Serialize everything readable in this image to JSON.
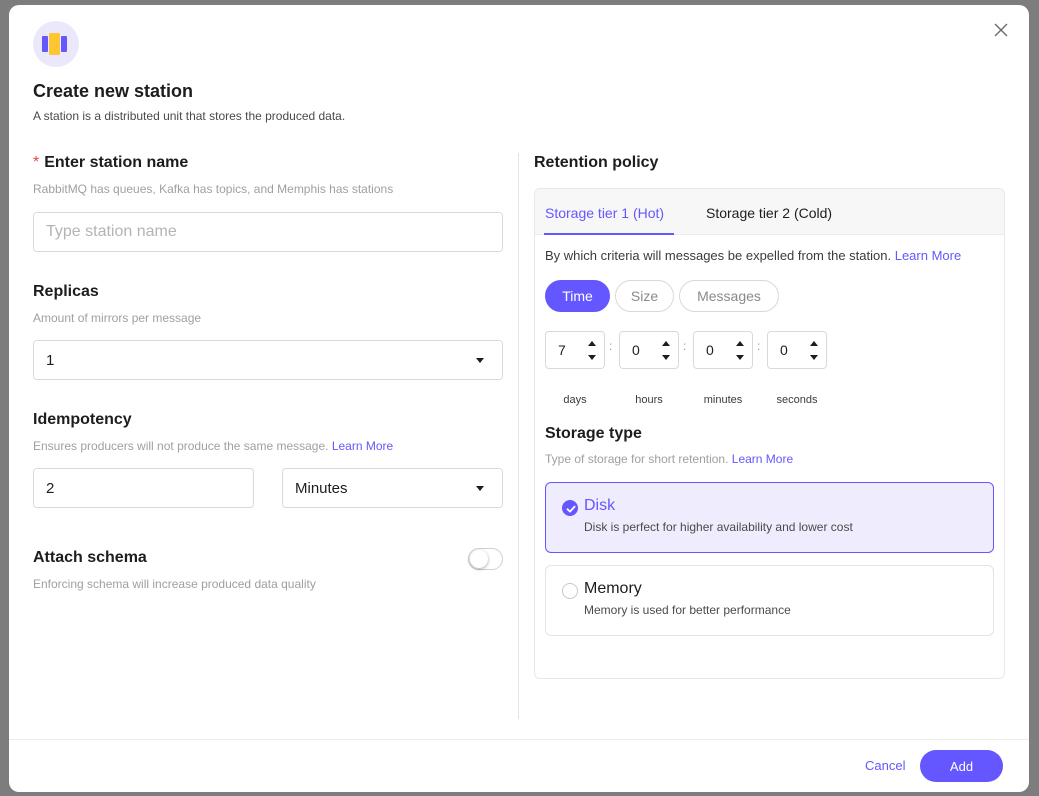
{
  "modal": {
    "title": "Create new station",
    "subtitle": "A station is a distributed unit that stores the produced data."
  },
  "station_name": {
    "label": "Enter station name",
    "required_mark": "*",
    "hint": "RabbitMQ has queues, Kafka has topics, and Memphis has stations",
    "placeholder": "Type station name",
    "value": ""
  },
  "replicas": {
    "label": "Replicas",
    "hint": "Amount of mirrors per message",
    "value": "1"
  },
  "idempotency": {
    "label": "Idempotency",
    "hint": "Ensures producers will not produce the same message.",
    "hint_link": "Learn More",
    "value": "2",
    "unit": "Minutes"
  },
  "schema": {
    "label": "Attach schema",
    "hint": "Enforcing schema will increase produced data quality",
    "enabled": false
  },
  "retention": {
    "label": "Retention policy",
    "tabs": [
      {
        "label": "Storage tier 1 (Hot)",
        "active": true
      },
      {
        "label": "Storage tier 2 (Cold)",
        "active": false
      }
    ],
    "criteria_text": "By which criteria will messages be expelled from the station.",
    "criteria_link": "Learn More",
    "types": [
      {
        "label": "Time",
        "active": true
      },
      {
        "label": "Size",
        "active": false
      },
      {
        "label": "Messages",
        "active": false
      }
    ],
    "time": {
      "days": {
        "value": "7",
        "label": "days"
      },
      "hours": {
        "value": "0",
        "label": "hours"
      },
      "minutes": {
        "value": "0",
        "label": "minutes"
      },
      "seconds": {
        "value": "0",
        "label": "seconds"
      },
      "separator": ":"
    }
  },
  "storage": {
    "label": "Storage type",
    "hint": "Type of storage for short retention.",
    "hint_link": "Learn More",
    "options": [
      {
        "title": "Disk",
        "desc": "Disk is perfect for higher availability and lower cost",
        "selected": true
      },
      {
        "title": "Memory",
        "desc": "Memory is used for better performance",
        "selected": false
      }
    ]
  },
  "footer": {
    "cancel_label": "Cancel",
    "add_label": "Add"
  },
  "colors": {
    "accent": "#6557ff",
    "logo_yellow": "#ffc633",
    "required": "#e5484d"
  },
  "icons": {
    "close": "close-icon",
    "logo": "memphis-logo-icon",
    "dropdown": "caret-down-icon",
    "check": "check-icon"
  }
}
